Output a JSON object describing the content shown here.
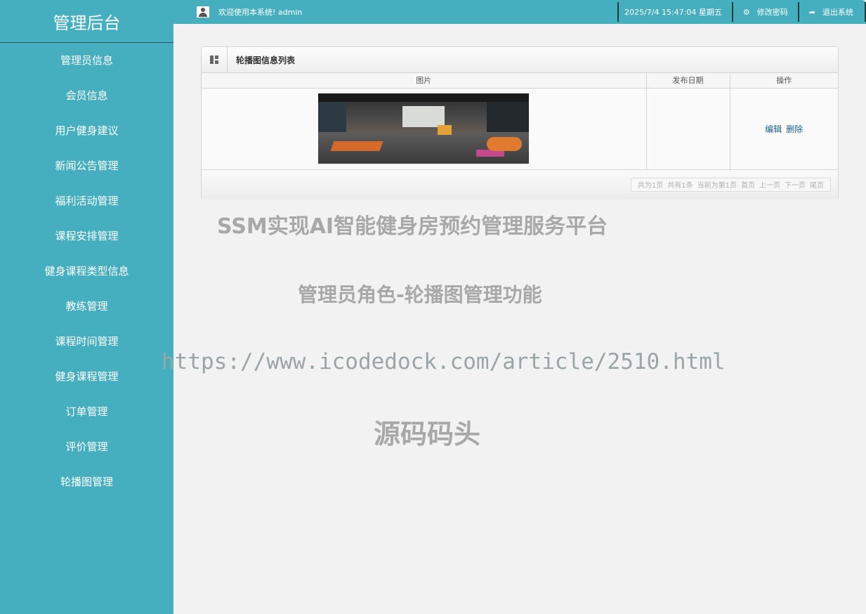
{
  "sidebar": {
    "brand": "管理后台",
    "items": [
      {
        "label": "管理员信息"
      },
      {
        "label": "会员信息"
      },
      {
        "label": "用户健身建议"
      },
      {
        "label": "新闻公告管理"
      },
      {
        "label": "福利活动管理"
      },
      {
        "label": "课程安排管理"
      },
      {
        "label": "健身课程类型信息"
      },
      {
        "label": "教练管理"
      },
      {
        "label": "课程时间管理"
      },
      {
        "label": "健身课程管理"
      },
      {
        "label": "订单管理"
      },
      {
        "label": "评价管理"
      },
      {
        "label": "轮播图管理"
      }
    ]
  },
  "header": {
    "welcome": "欢迎使用本系统! admin",
    "datetime": "2025/7/4 15:47:04 星期五",
    "change_password": "修改密码",
    "logout": "退出系统"
  },
  "panel": {
    "title": "轮播图信息列表",
    "columns": [
      "图片",
      "发布日期",
      "操作"
    ],
    "rows": [
      {
        "image": "gym-interior-photo",
        "date": "",
        "edit": "编辑",
        "delete": "删除"
      }
    ],
    "pager": {
      "total_pages": "共为1页",
      "total_items": "共有1条",
      "current": "当前为第1页",
      "first": "首页",
      "prev": "上一页",
      "next": "下一页",
      "last": "尾页"
    }
  },
  "watermark": {
    "line1": "SSM实现AI智能健身房预约管理服务平台",
    "line2": "管理员角色-轮播图管理功能",
    "line3": "https://www.icodedock.com/article/2510.html",
    "line4": "源码码头"
  },
  "colors": {
    "accent": "#46afbf",
    "background": "#f2f2f2",
    "link": "#1f5f88"
  },
  "icons": {
    "user": "user-icon",
    "gear": "gear-icon",
    "logout": "share-arrow-icon",
    "panel": "layout-grid-icon"
  }
}
